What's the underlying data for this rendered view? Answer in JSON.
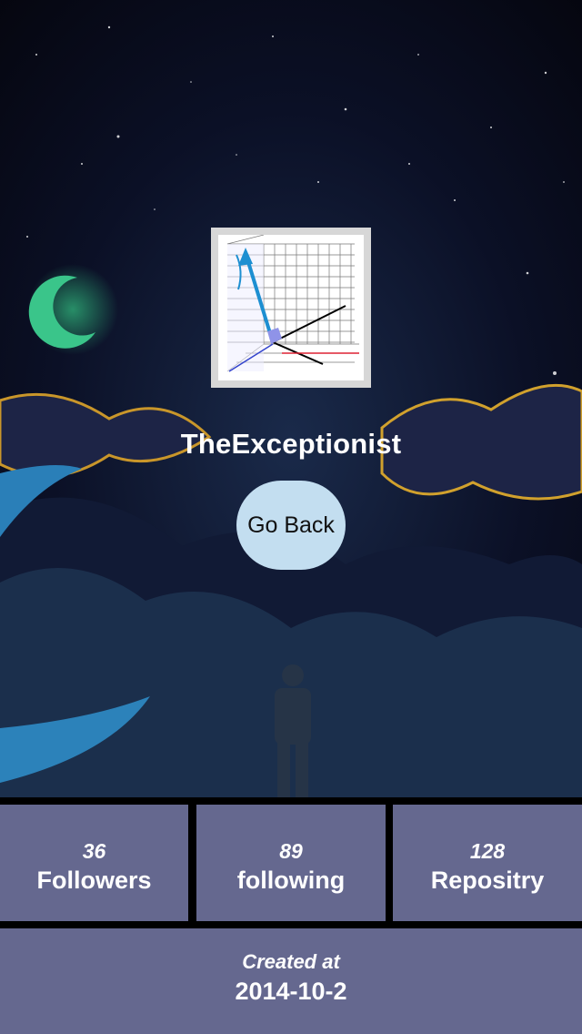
{
  "profile": {
    "username": "TheExceptionist",
    "go_back_label": "Go Back"
  },
  "stats": {
    "followers": {
      "count": "36",
      "label": "Followers"
    },
    "following": {
      "count": "89",
      "label": "following"
    },
    "repos": {
      "count": "128",
      "label": "Repositry"
    }
  },
  "created": {
    "label": "Created at",
    "date": "2014-10-2"
  },
  "colors": {
    "panel": "#65688f",
    "button": "#c3def0",
    "background": "#000000"
  }
}
